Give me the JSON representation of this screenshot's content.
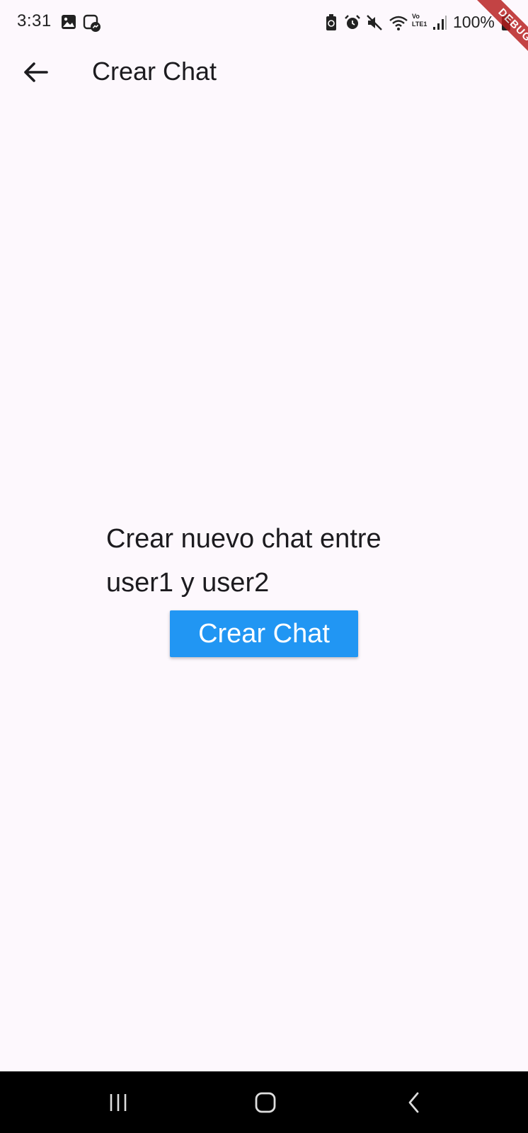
{
  "status_bar": {
    "time": "3:31",
    "battery_percent": "100%",
    "left_icons": [
      "gallery-icon",
      "messenger-icon"
    ],
    "right_icons": [
      "battery-saver-icon",
      "alarm-icon",
      "mute-icon",
      "wifi-icon",
      "volte-icon",
      "signal-icon",
      "battery-icon"
    ],
    "volte_label": "Vo",
    "lte_label": "LTE1"
  },
  "debug_banner": {
    "label": "DEBUG",
    "color": "#b71c1c"
  },
  "app_bar": {
    "title": "Crear Chat",
    "back_icon": "arrow-back-icon"
  },
  "main": {
    "prompt": "Crear nuevo chat entre user1 y user2",
    "create_button_label": "Crear Chat",
    "accent_color": "#2196f3"
  },
  "nav_bar": {
    "buttons": [
      "recent-apps-icon",
      "home-icon",
      "back-icon"
    ]
  },
  "colors": {
    "background": "#fdf8fd",
    "text": "#1c1b1f",
    "nav_background": "#000000"
  }
}
